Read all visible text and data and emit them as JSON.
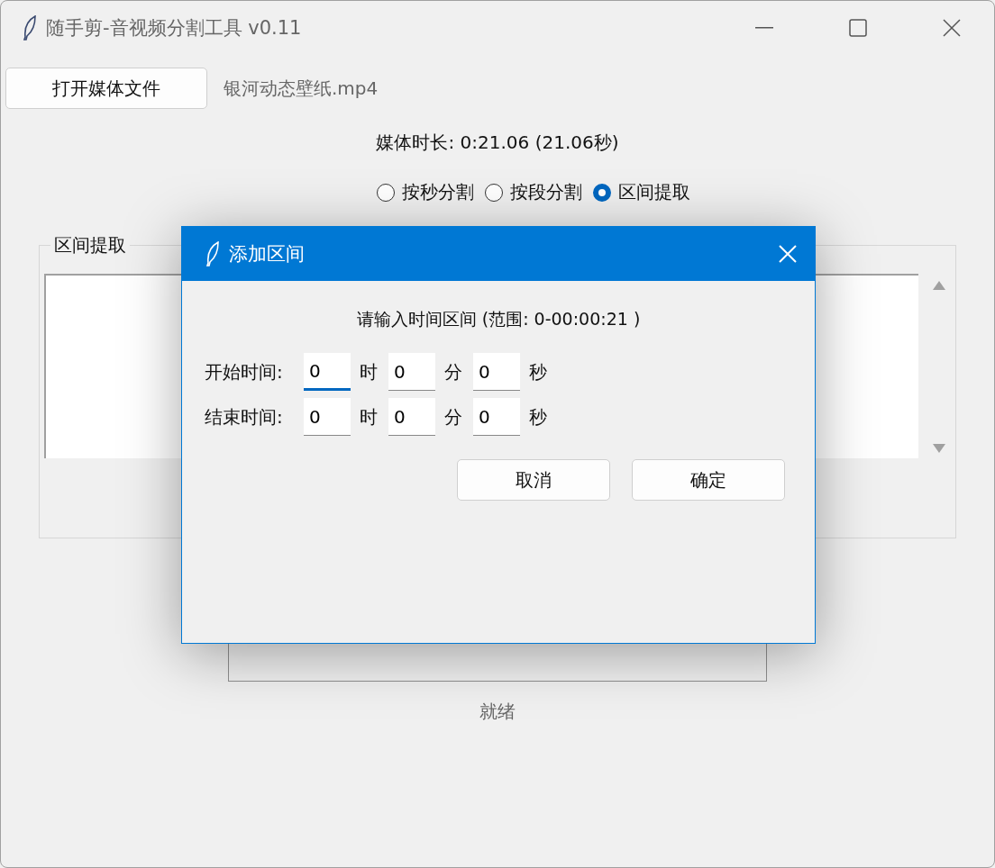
{
  "window": {
    "title": "随手剪-音视频分割工具 v0.11"
  },
  "open_button": "打开媒体文件",
  "file_name": "银河动态壁纸.mp4",
  "duration": "媒体时长: 0:21.06 (21.06秒)",
  "modes": [
    {
      "label": "按秒分割",
      "selected": false
    },
    {
      "label": "按段分割",
      "selected": false
    },
    {
      "label": "区间提取",
      "selected": true
    }
  ],
  "group": {
    "title": "区间提取"
  },
  "progress": {
    "level": 0
  },
  "status": "就绪",
  "dialog": {
    "title": "添加区间",
    "prompt": "请输入时间区间 (范围: 0-00:00:21 )",
    "rows": [
      {
        "label": "开始时间:",
        "fields": [
          {
            "value": "0",
            "unit": "时",
            "focused": true
          },
          {
            "value": "0",
            "unit": "分",
            "focused": false
          },
          {
            "value": "0",
            "unit": "秒",
            "focused": false
          }
        ]
      },
      {
        "label": "结束时间:",
        "fields": [
          {
            "value": "0",
            "unit": "时",
            "focused": false
          },
          {
            "value": "0",
            "unit": "分",
            "focused": false
          },
          {
            "value": "0",
            "unit": "秒",
            "focused": false
          }
        ]
      }
    ],
    "buttons": [
      "取消",
      "确定"
    ]
  }
}
